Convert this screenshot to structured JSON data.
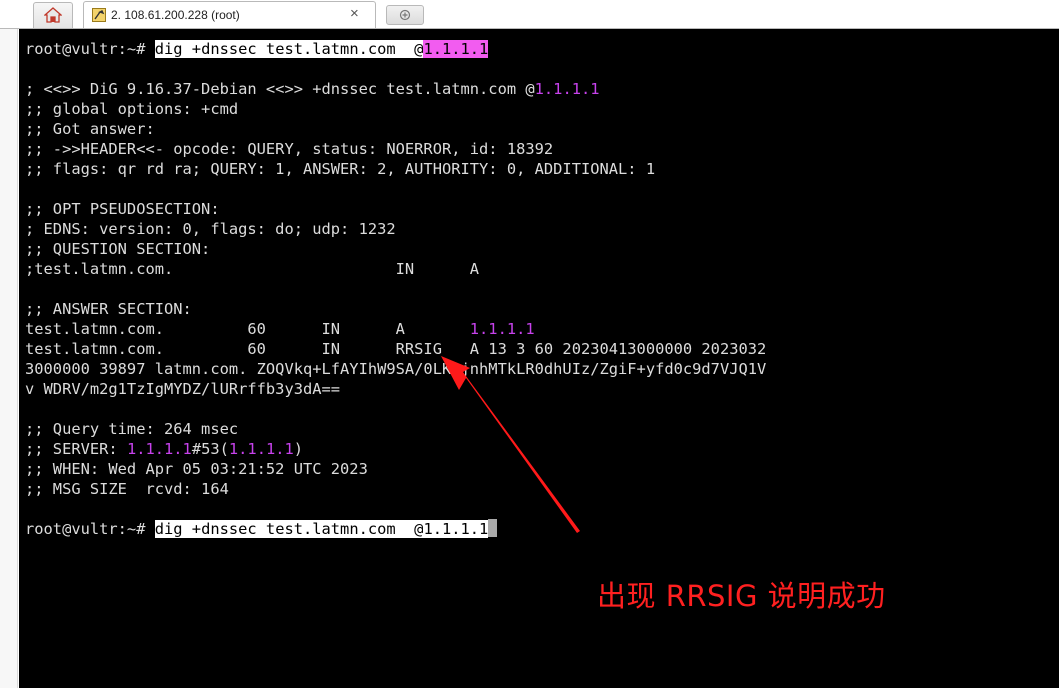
{
  "window": {
    "tab_title": "2. 108.61.200.228 (root)",
    "close_glyph": "×"
  },
  "terminal": {
    "prompt": "root@vultr:~# ",
    "command1": "dig +dnssec test.latmn.com  @",
    "server_ip": "1.1.1.1",
    "banner_prefix": "; <<>> DiG 9.16.37-Debian <<>> +dnssec test.latmn.com @",
    "global_options": ";; global options: +cmd",
    "got_answer": ";; Got answer:",
    "header": ";; ->>HEADER<<- opcode: QUERY, status: NOERROR, id: 18392",
    "flags": ";; flags: qr rd ra; QUERY: 1, ANSWER: 2, AUTHORITY: 0, ADDITIONAL: 1",
    "opt_section": ";; OPT PSEUDOSECTION:",
    "edns": "; EDNS: version: 0, flags: do; udp: 1232",
    "question_section": ";; QUESTION SECTION:",
    "question_row": ";test.latmn.com.                        IN      A",
    "answer_section": ";; ANSWER SECTION:",
    "answer_a_prefix": "test.latmn.com.         60      IN      A       ",
    "answer_rrsig_1": "test.latmn.com.         60      IN      RRSIG   A 13 3 60 20230413000000 2023032",
    "answer_rrsig_2": "3000000 39897 latmn.com. ZOQVkq+LfAYIhW9SA/0LKxjnhMTkLR0dhUIz/ZgiF+yfd0c9d7VJQ1V",
    "answer_rrsig_3": "v WDRV/m2g1TzIgMYDZ/lURrffb3y3dA==",
    "query_time": ";; Query time: 264 msec",
    "server_prefix": ";; SERVER: ",
    "server_port": "#53(",
    "server_suffix": ")",
    "when": ";; WHEN: Wed Apr 05 03:21:52 UTC 2023",
    "msg_size": ";; MSG SIZE  rcvd: 164",
    "command2": "dig +dnssec test.latmn.com  @1.1.1.1"
  },
  "annotation": {
    "text": "出现 RRSIG 说明成功",
    "color": "#ff2020"
  },
  "colors": {
    "terminal_bg": "#000000",
    "terminal_fg": "#dcdcdc",
    "ip_magenta": "#c742ec",
    "ip_highlight": "#f25cf0"
  }
}
